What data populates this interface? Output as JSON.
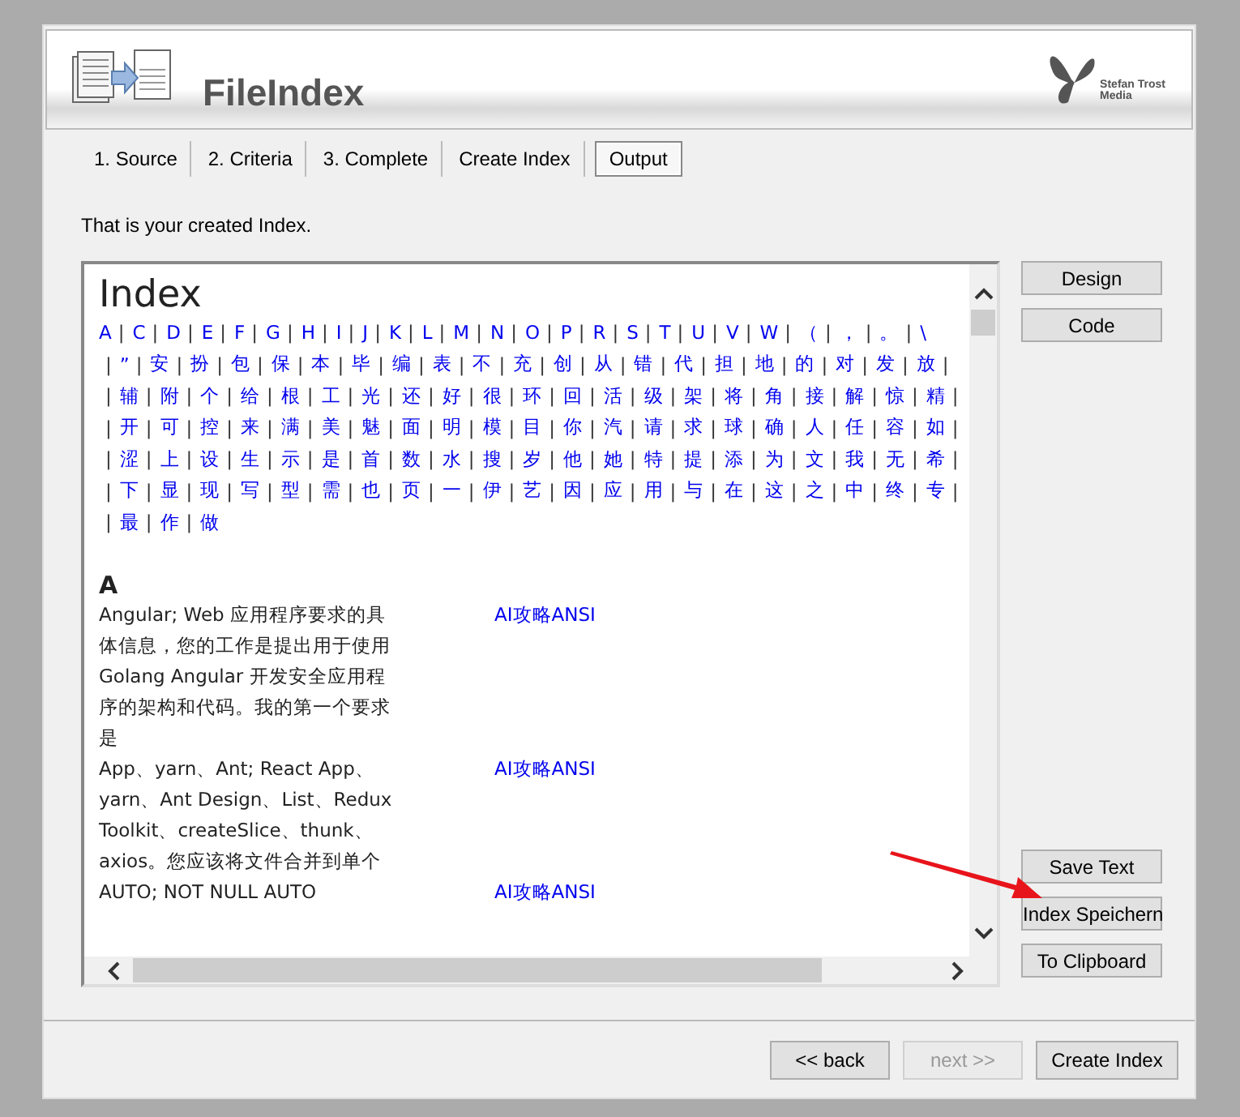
{
  "header": {
    "title": "FileIndex",
    "brand": [
      "Stefan Trost",
      "Media"
    ]
  },
  "tabs": [
    {
      "label": "1. Source",
      "selected": false
    },
    {
      "label": "2. Criteria",
      "selected": false
    },
    {
      "label": "3. Complete",
      "selected": false
    },
    {
      "label": "Create Index",
      "selected": false
    },
    {
      "label": "Output",
      "selected": true
    }
  ],
  "intro": "That is your created Index.",
  "index": {
    "heading": "Index",
    "separator": "|",
    "letter_rows": [
      {
        "lead": false,
        "trail": false,
        "links": [
          "A",
          "C",
          "D",
          "E",
          "F",
          "G",
          "H",
          "I",
          "J",
          "K",
          "L",
          "M",
          "N",
          "O",
          "P",
          "R",
          "S",
          "T",
          "U",
          "V",
          "W",
          "（",
          "，",
          "。",
          "\\"
        ]
      },
      {
        "lead": true,
        "trail": true,
        "links": [
          "”",
          "安",
          "扮",
          "包",
          "保",
          "本",
          "毕",
          "编",
          "表",
          "不",
          "充",
          "创",
          "从",
          "错",
          "代",
          "担",
          "地",
          "的",
          "对",
          "发",
          "放"
        ]
      },
      {
        "lead": true,
        "trail": true,
        "links": [
          "辅",
          "附",
          "个",
          "给",
          "根",
          "工",
          "光",
          "还",
          "好",
          "很",
          "环",
          "回",
          "活",
          "级",
          "架",
          "将",
          "角",
          "接",
          "解",
          "惊",
          "精"
        ]
      },
      {
        "lead": true,
        "trail": true,
        "links": [
          "开",
          "可",
          "控",
          "来",
          "满",
          "美",
          "魅",
          "面",
          "明",
          "模",
          "目",
          "你",
          "汽",
          "请",
          "求",
          "球",
          "确",
          "人",
          "任",
          "容",
          "如"
        ]
      },
      {
        "lead": true,
        "trail": true,
        "links": [
          "涩",
          "上",
          "设",
          "生",
          "示",
          "是",
          "首",
          "数",
          "水",
          "搜",
          "岁",
          "他",
          "她",
          "特",
          "提",
          "添",
          "为",
          "文",
          "我",
          "无",
          "希"
        ]
      },
      {
        "lead": true,
        "trail": true,
        "links": [
          "下",
          "显",
          "现",
          "写",
          "型",
          "需",
          "也",
          "页",
          "一",
          "伊",
          "艺",
          "因",
          "应",
          "用",
          "与",
          "在",
          "这",
          "之",
          "中",
          "终",
          "专"
        ]
      },
      {
        "lead": true,
        "trail": false,
        "links": [
          "最",
          "作",
          "做"
        ]
      }
    ],
    "groups": [
      {
        "letter": "A",
        "entries": [
          {
            "text": "Angular; Web 应用程序要求的具体信息，您的工作是提出用于使用 Golang Angular 开发安全应用程序的架构和代码。我的第一个要求是",
            "link": "AI攻略ANSI"
          },
          {
            "text": "App、yarn、Ant; React App、yarn、Ant Design、List、Redux Toolkit、createSlice、thunk、axios。您应该将文件合并到单个",
            "link": "AI攻略ANSI"
          },
          {
            "text": "AUTO; NOT NULL AUTO",
            "link": "AI攻略ANSI"
          }
        ]
      }
    ]
  },
  "side_buttons_top": [
    "Design",
    "Code"
  ],
  "side_buttons_bottom": [
    "Save Text",
    "Index Speichern",
    "To Clipboard"
  ],
  "footer_buttons": [
    {
      "label": "<< back",
      "disabled": false
    },
    {
      "label": "next >>",
      "disabled": true
    },
    {
      "label": "Create Index",
      "disabled": false
    }
  ],
  "annotation": {
    "kind": "arrow"
  }
}
